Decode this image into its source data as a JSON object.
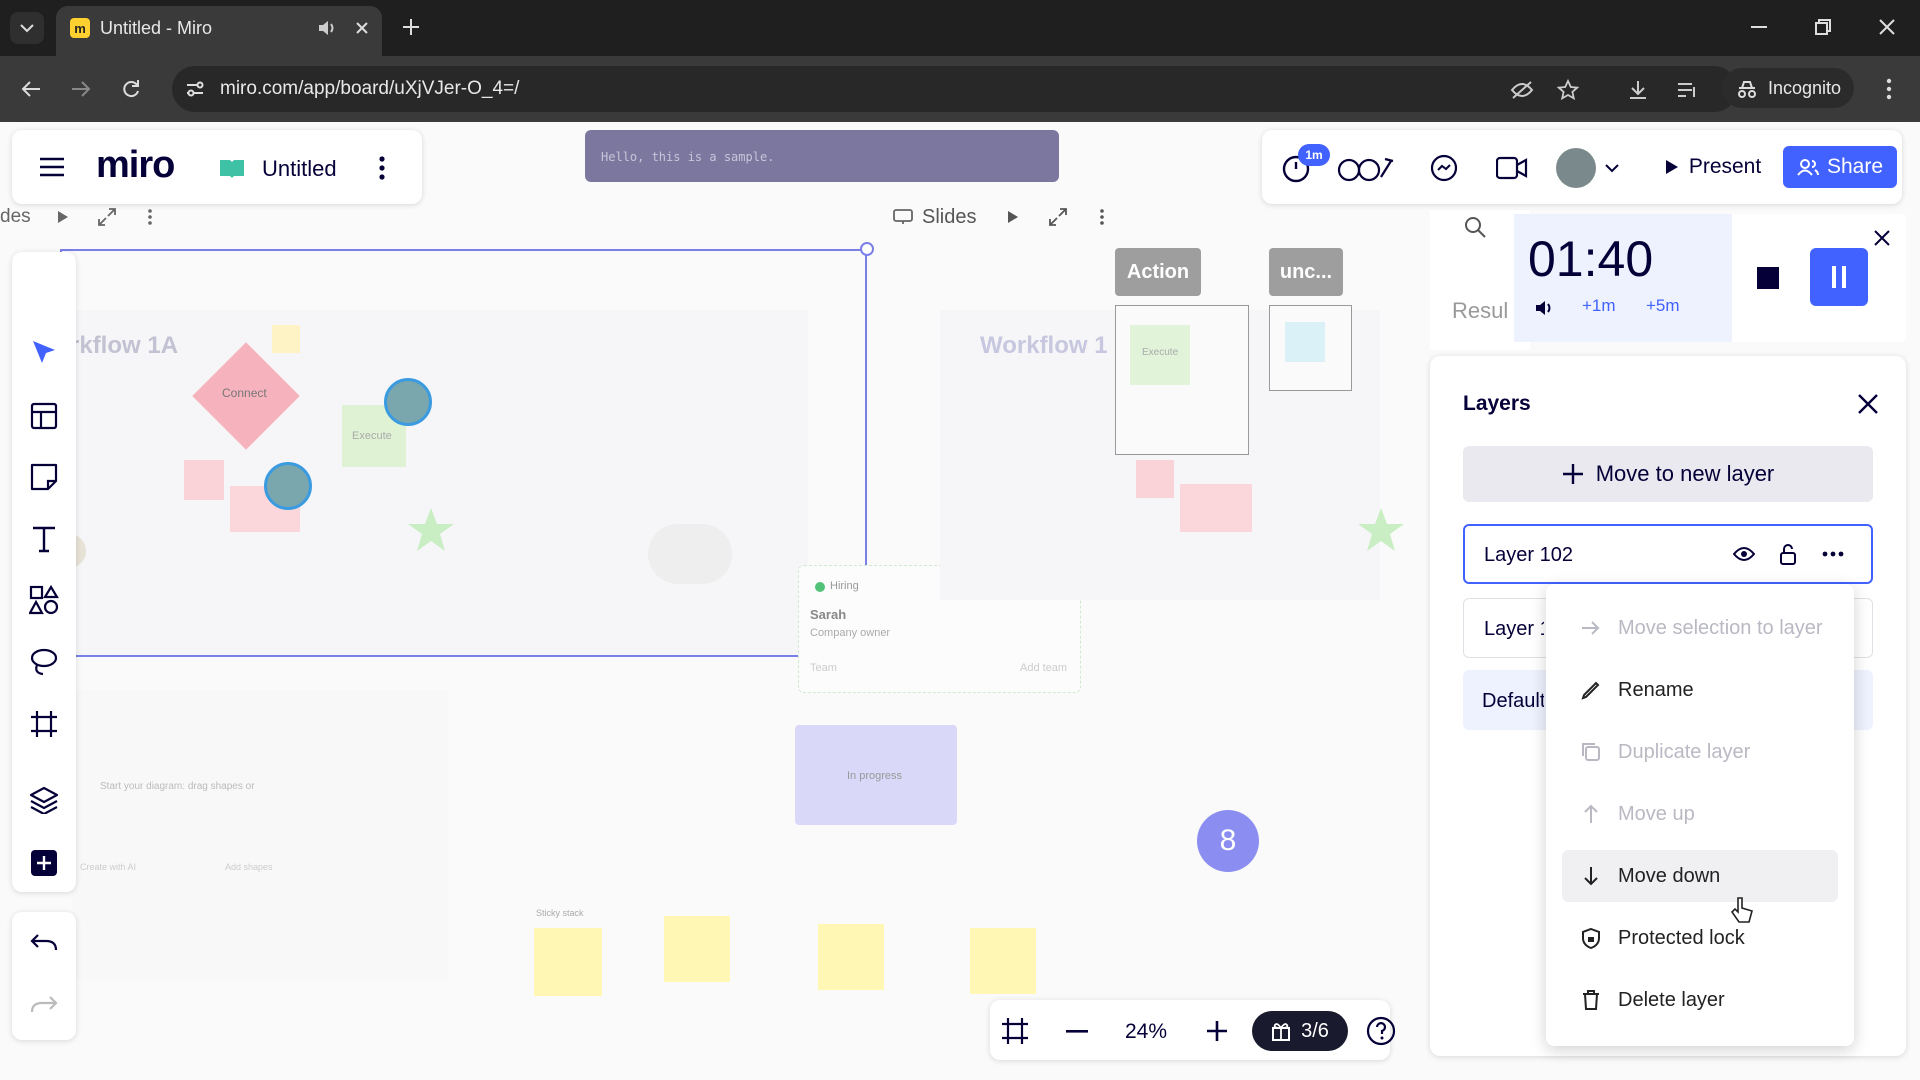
{
  "browser": {
    "tab_title": "Untitled - Miro",
    "url": "miro.com/app/board/uXjVJer-O_4=/",
    "incognito_label": "Incognito"
  },
  "board": {
    "logo": "miro",
    "name": "Untitled",
    "sample_text": "Hello, this is a sample.",
    "present_label": "Present",
    "share_label": "Share",
    "notification_badge": "1m"
  },
  "frames": {
    "left_partial_label": "des",
    "slides_label": "Slides",
    "workflow_1a": "rkflow 1A",
    "workflow_1b": "Workflow 1",
    "connect": "Connect",
    "execute": "Execute",
    "tag_action": "Action",
    "tag_unc": "unc...",
    "hiring": "Hiring",
    "sarah": "Sarah",
    "company_owner": "Company owner",
    "team": "Team",
    "add_team": "Add team",
    "in_progress": "In progress",
    "start_diagram": "Start your diagram: drag shapes or",
    "create_ai": "Create with AI",
    "add_shapes": "Add shapes",
    "sticky_stack": "Sticky stack",
    "marker_8": "8"
  },
  "search": {
    "results_label": "Resul"
  },
  "timer": {
    "value": "01:40",
    "plus1": "+1m",
    "plus5": "+5m"
  },
  "layers": {
    "title": "Layers",
    "move_new": "Move to new layer",
    "items": [
      "Layer 102",
      "Layer 1",
      "Default"
    ]
  },
  "context_menu": {
    "items": [
      {
        "label": "Move selection to layer",
        "icon": "arrow-right-icon",
        "enabled": false
      },
      {
        "label": "Rename",
        "icon": "pencil-icon",
        "enabled": true
      },
      {
        "label": "Duplicate layer",
        "icon": "duplicate-icon",
        "enabled": false
      },
      {
        "label": "Move up",
        "icon": "arrow-up-icon",
        "enabled": false
      },
      {
        "label": "Move down",
        "icon": "arrow-down-icon",
        "enabled": true
      },
      {
        "label": "Protected lock",
        "icon": "shield-lock-icon",
        "enabled": true
      },
      {
        "label": "Delete layer",
        "icon": "trash-icon",
        "enabled": true
      }
    ]
  },
  "zoom": {
    "level": "24%",
    "pages": "3/6"
  },
  "colors": {
    "accent": "#4262ff",
    "chrome_dark": "#1f1f1f"
  }
}
